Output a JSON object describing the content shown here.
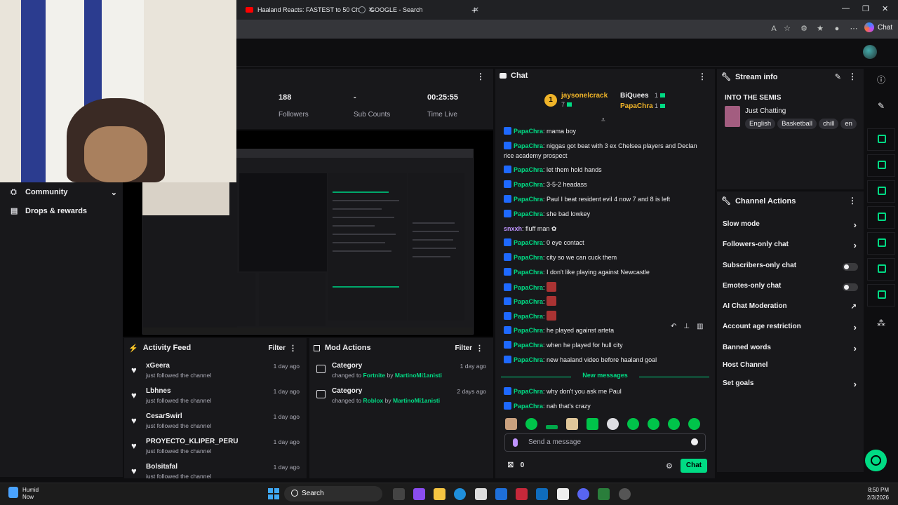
{
  "browser": {
    "tabs": [
      {
        "title": "Haaland Reacts: FASTEST to 50 Ch",
        "icon": "youtube-icon"
      },
      {
        "title": "GOOGLE - Search",
        "icon": "globe-icon"
      }
    ],
    "copilot_label": "Chat"
  },
  "nav": {
    "community": "Community",
    "drops": "Drops & rewards"
  },
  "stats": {
    "followers_value": "188",
    "followers_label": "Followers",
    "subs_value": "-",
    "subs_label": "Sub Counts",
    "time_value": "00:25:55",
    "time_label": "Time Live"
  },
  "activity": {
    "title": "Activity Feed",
    "filter": "Filter",
    "items": [
      {
        "name": "xGeera",
        "sub": "just followed the channel",
        "time": "1 day ago"
      },
      {
        "name": "Lbhnes",
        "sub": "just followed the channel",
        "time": "1 day ago"
      },
      {
        "name": "CesarSwirl",
        "sub": "just followed the channel",
        "time": "1 day ago"
      },
      {
        "name": "PROYECTO_KLIPER_PERU",
        "sub": "just followed the channel",
        "time": "1 day ago"
      },
      {
        "name": "Bolsitafal",
        "sub": "just followed the channel",
        "time": "1 day ago"
      }
    ]
  },
  "mod": {
    "title": "Mod Actions",
    "filter": "Filter",
    "items": [
      {
        "title": "Category",
        "prefix": "changed to",
        "game": "Fortnite",
        "by": "by",
        "user": "MartinoMi1anisti",
        "time": "1 day ago"
      },
      {
        "title": "Category",
        "prefix": "changed to",
        "game": "Roblox",
        "by": "by",
        "user": "MartinoMi1anisti",
        "time": "2 days ago"
      }
    ]
  },
  "chat": {
    "title": "Chat",
    "leader": {
      "rank": "1",
      "first_name": "jaysonelcrack",
      "first_count": "7",
      "second_name": "BiQuees",
      "second_count": "1",
      "third_name": "PapaChra",
      "third_count": "1"
    },
    "messages": [
      {
        "user": "PapaChra",
        "text": ": mama boy"
      },
      {
        "user": "PapaChra",
        "text": ": niggas got beat with 3 ex Chelsea players and Declan rice academy prospect"
      },
      {
        "user": "PapaChra",
        "text": ": let them hold hands"
      },
      {
        "user": "PapaChra",
        "text": ": 3-5-2 headass"
      },
      {
        "user": "PapaChra",
        "text": ": Paul I beat resident evil 4 now 7 and 8 is left"
      },
      {
        "user": "PapaChra",
        "text": ": she bad lowkey"
      },
      {
        "user": "snxxh",
        "text": ": fluff man ✿"
      },
      {
        "user": "PapaChra",
        "text": ": 0 eye contact"
      },
      {
        "user": "PapaChra",
        "text": ": city so we can cuck them"
      },
      {
        "user": "PapaChra",
        "text": ": I don't like playing against Newcastle"
      },
      {
        "user": "PapaChra",
        "text": ":"
      },
      {
        "user": "PapaChra",
        "text": ":"
      },
      {
        "user": "PapaChra",
        "text": ":"
      },
      {
        "user": "PapaChra",
        "text": ": he played against arteta"
      },
      {
        "user": "PapaChra",
        "text": ": when he played for hull city"
      },
      {
        "user": "PapaChra",
        "text": ": new haaland video before haaland goal"
      }
    ],
    "new_messages_label": "New messages",
    "new_messages": [
      {
        "user": "PapaChra",
        "text": ": why don't you ask me Paul"
      },
      {
        "user": "PapaChra",
        "text": ": nah that's crazy"
      }
    ],
    "input_placeholder": "Send a message",
    "points": "0",
    "send_label": "Chat"
  },
  "stream_info": {
    "title": "Stream info",
    "stream_title": "INTO THE SEMIS",
    "category": "Just Chatting",
    "tags": [
      "English",
      "Basketball",
      "chill",
      "en"
    ]
  },
  "channel_actions": {
    "title": "Channel Actions",
    "items": [
      {
        "label": "Slow mode",
        "control": "arrow"
      },
      {
        "label": "Followers-only chat",
        "control": "arrow"
      },
      {
        "label": "Subscribers-only chat",
        "control": "toggle"
      },
      {
        "label": "Emotes-only chat",
        "control": "toggle"
      },
      {
        "label": "AI Chat Moderation",
        "control": "external"
      },
      {
        "label": "Account age restriction",
        "control": "arrow"
      },
      {
        "label": "Banned words",
        "control": "arrow"
      },
      {
        "label": "Host Channel",
        "control": "none"
      },
      {
        "label": "Set goals",
        "control": "arrow"
      }
    ]
  },
  "taskbar": {
    "weather_title": "Humid",
    "weather_sub": "Now",
    "search": "Search",
    "time": "8:50 PM",
    "date": "2/3/2026"
  }
}
